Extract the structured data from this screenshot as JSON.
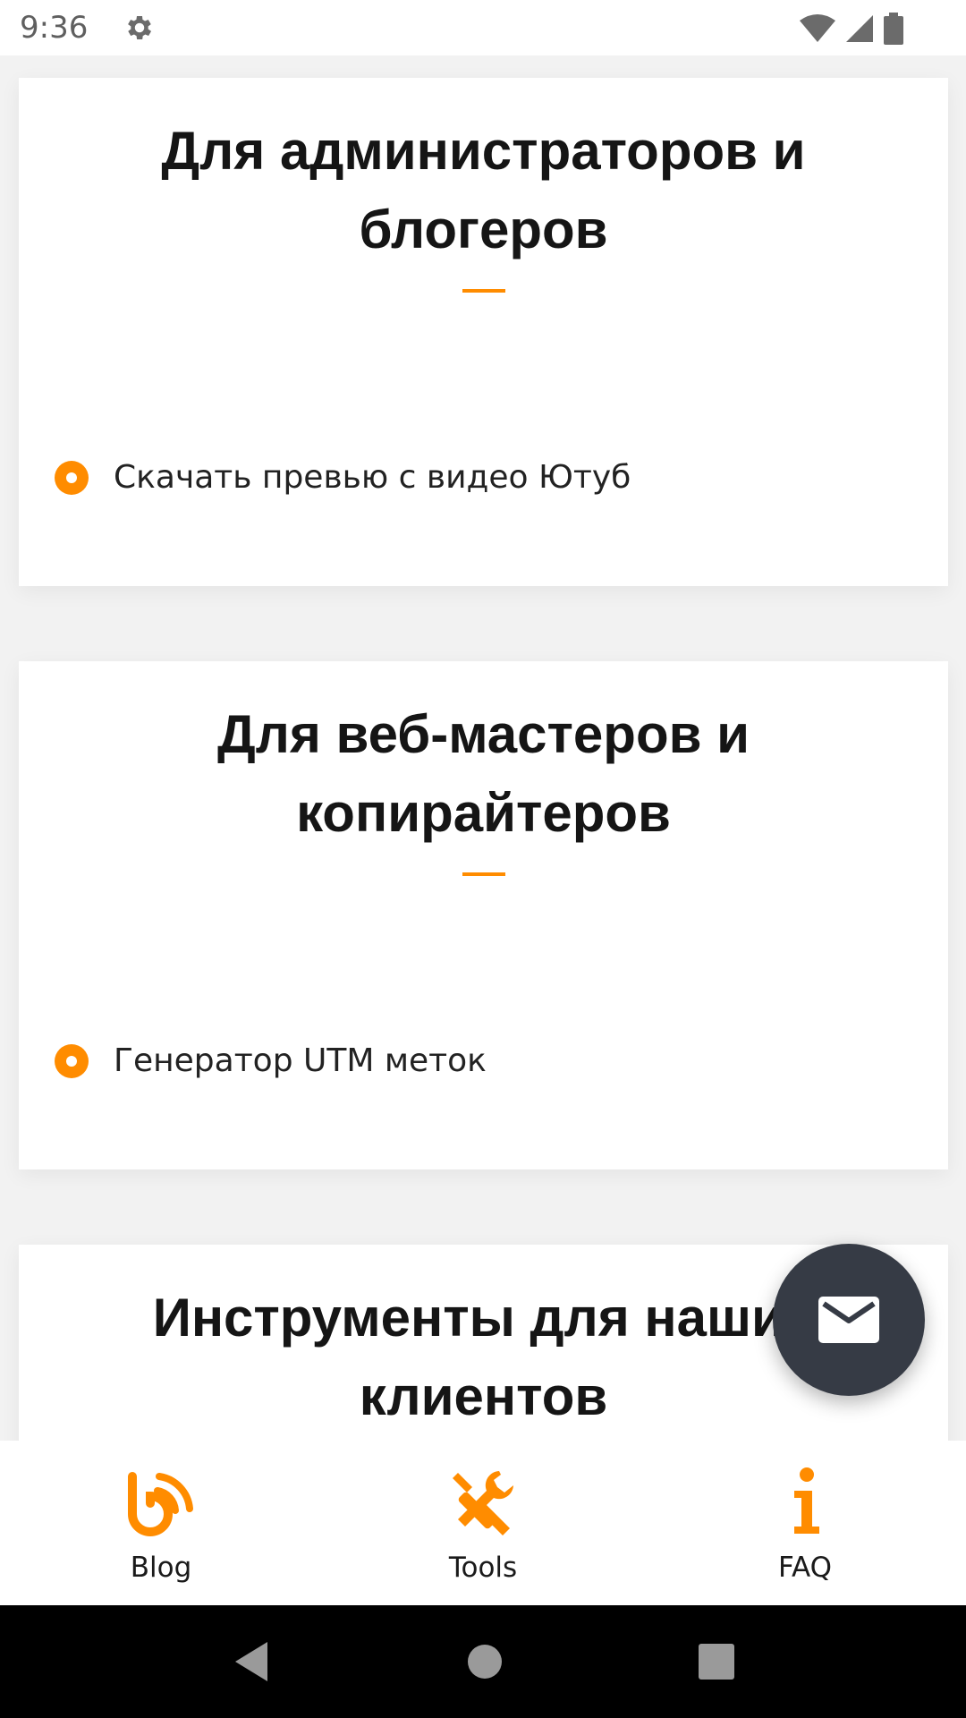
{
  "status_bar": {
    "time": "9:36",
    "icons": [
      "gear-icon",
      "wifi-icon",
      "signal-icon",
      "battery-icon"
    ]
  },
  "cards": [
    {
      "title": "Для администраторов и блогеров",
      "items": [
        "Скачать превью с видео Ютуб"
      ]
    },
    {
      "title": "Для веб-мастеров и копирайтеров",
      "items": [
        "Генератор UTM меток"
      ]
    },
    {
      "title": "Инструменты для наших клиентов",
      "items": []
    }
  ],
  "fab": {
    "icon": "mail-icon"
  },
  "bottom_nav": {
    "items": [
      {
        "label": "Blog",
        "icon": "blog-rss-icon"
      },
      {
        "label": "Tools",
        "icon": "tools-icon"
      },
      {
        "label": "FAQ",
        "icon": "info-icon"
      }
    ]
  },
  "system_nav": {
    "buttons": [
      "back-icon",
      "home-icon",
      "recents-icon"
    ]
  },
  "colors": {
    "accent": "#ff8c00",
    "fab": "#363b45",
    "background": "#f2f2f2"
  }
}
